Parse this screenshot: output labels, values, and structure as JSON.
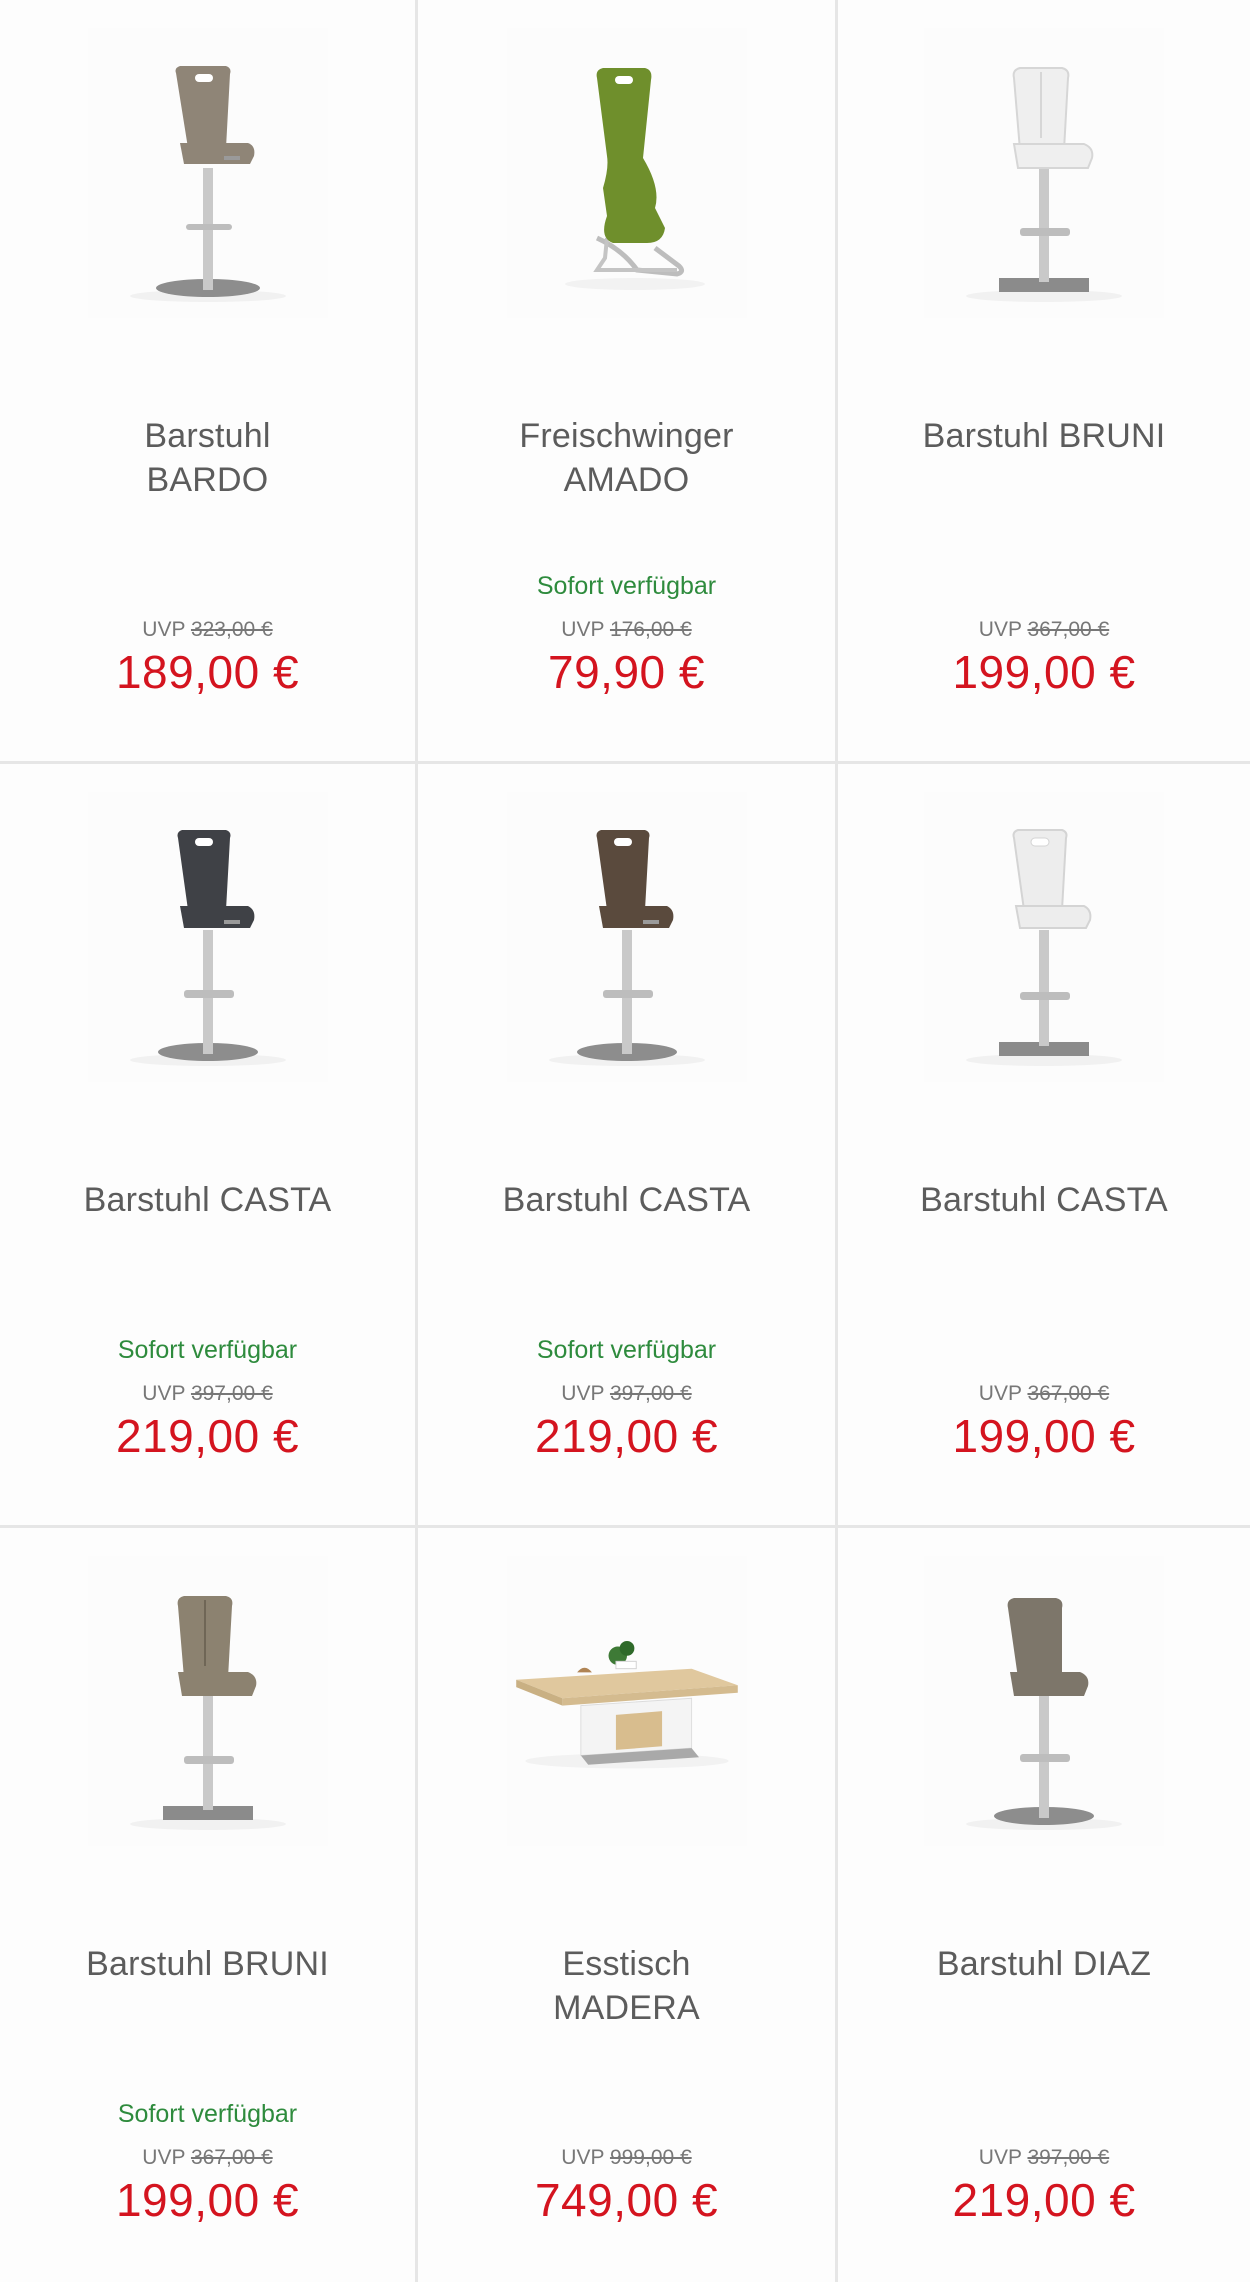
{
  "products": [
    {
      "title_line1": "Barstuhl",
      "title_line2": "BARDO",
      "availability": "",
      "uvp_label": "UVP",
      "uvp_old_price": "323,00 €",
      "price": "189,00 €",
      "image": "bar-stool-handle-icon",
      "seat_color": "#8f8577"
    },
    {
      "title_line1": "Freischwinger",
      "title_line2": "AMADO",
      "availability": "Sofort verfügbar",
      "uvp_label": "UVP",
      "uvp_old_price": "176,00 €",
      "price": "79,90 €",
      "image": "cantilever-chair-icon",
      "seat_color": "#6f8f2c"
    },
    {
      "title_line1": "Barstuhl BRUNI",
      "title_line2": "",
      "availability": "",
      "uvp_label": "UVP",
      "uvp_old_price": "367,00 €",
      "price": "199,00 €",
      "image": "bar-stool-icon",
      "seat_color": "#efefef"
    },
    {
      "title_line1": "Barstuhl CASTA",
      "title_line2": "",
      "availability": "Sofort verfügbar",
      "uvp_label": "UVP",
      "uvp_old_price": "397,00 €",
      "price": "219,00 €",
      "image": "bar-stool-handle-icon",
      "seat_color": "#3f4146"
    },
    {
      "title_line1": "Barstuhl CASTA",
      "title_line2": "",
      "availability": "Sofort verfügbar",
      "uvp_label": "UVP",
      "uvp_old_price": "397,00 €",
      "price": "219,00 €",
      "image": "bar-stool-handle-icon",
      "seat_color": "#5a4a3d"
    },
    {
      "title_line1": "Barstuhl CASTA",
      "title_line2": "",
      "availability": "",
      "uvp_label": "UVP",
      "uvp_old_price": "367,00 €",
      "price": "199,00 €",
      "image": "bar-stool-handle-icon",
      "seat_color": "#ededed"
    },
    {
      "title_line1": "Barstuhl BRUNI",
      "title_line2": "",
      "availability": "Sofort verfügbar",
      "uvp_label": "UVP",
      "uvp_old_price": "367,00 €",
      "price": "199,00 €",
      "image": "bar-stool-icon",
      "seat_color": "#8c8270"
    },
    {
      "title_line1": "Esstisch",
      "title_line2": "MADERA",
      "availability": "",
      "uvp_label": "UVP",
      "uvp_old_price": "999,00 €",
      "price": "749,00 €",
      "image": "dining-table-icon",
      "seat_color": "#d9c29a"
    },
    {
      "title_line1": "Barstuhl DIAZ",
      "title_line2": "",
      "availability": "",
      "uvp_label": "UVP",
      "uvp_old_price": "397,00 €",
      "price": "219,00 €",
      "image": "bar-stool-icon",
      "seat_color": "#7d766a"
    }
  ]
}
